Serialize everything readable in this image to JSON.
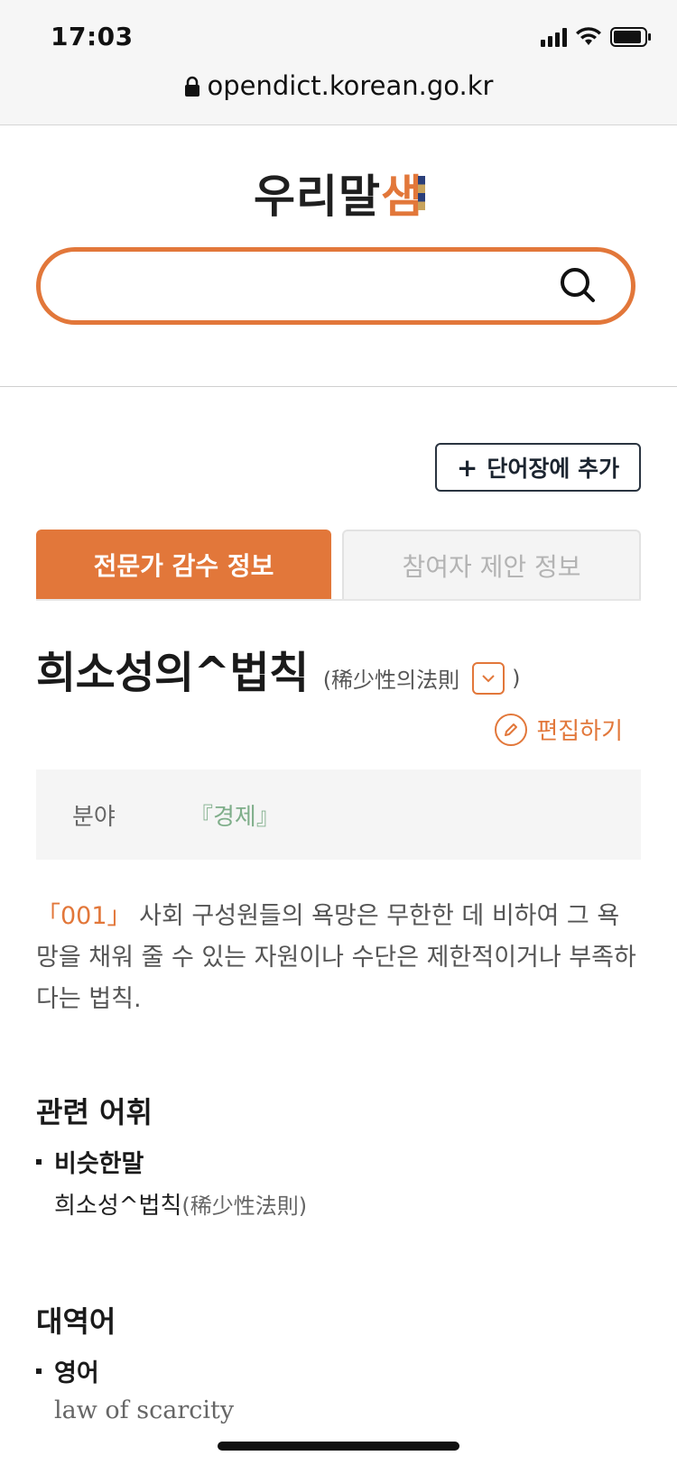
{
  "status_bar": {
    "time": "17:03"
  },
  "browser": {
    "url": "opendict.korean.go.kr"
  },
  "header": {
    "logo_text": "우리말",
    "logo_accent": "샘",
    "search_placeholder": ""
  },
  "actions": {
    "add_wordbook": "단어장에 추가",
    "edit": "편집하기"
  },
  "tabs": [
    {
      "label": "전문가 감수 정보",
      "active": true
    },
    {
      "label": "참여자 제안 정보",
      "active": false
    }
  ],
  "entry": {
    "headword": "희소성의^법칙",
    "hanja_open": "(稀少性의法則",
    "hanja_close": ")",
    "field_label": "분야",
    "field_value": "『경제』",
    "definition_number": "「001」",
    "definition_text": "사회 구성원들의 욕망은 무한한 데 비하여 그 욕망을 채워 줄 수 있는 자원이나 수단은 제한적이거나 부족하다는 법칙."
  },
  "related": {
    "title": "관련 어휘",
    "category": "비슷한말",
    "word": "희소성^법칙",
    "word_hanja": "(稀少性法則)"
  },
  "translation": {
    "title": "대역어",
    "language": "영어",
    "value": "law of scarcity"
  },
  "colors": {
    "accent": "#e2773a",
    "field_value": "#7fae8a"
  }
}
